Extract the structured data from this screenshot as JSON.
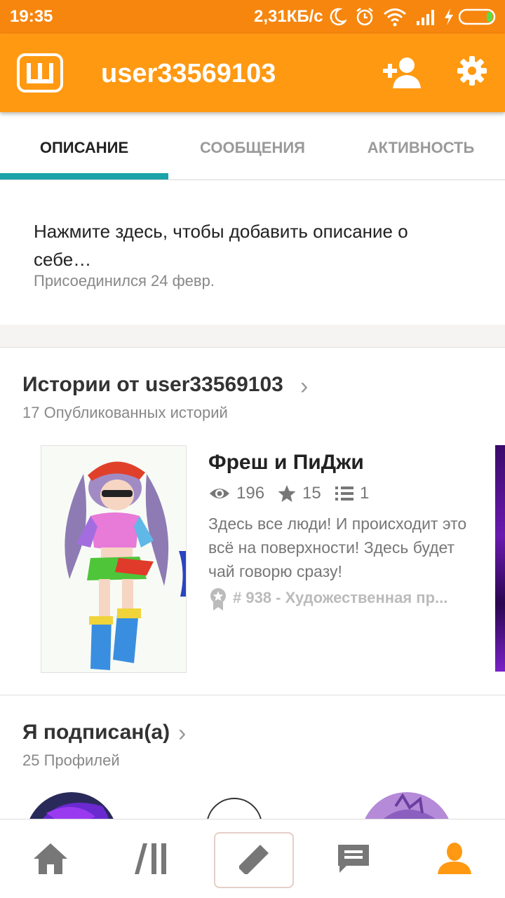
{
  "status_bar": {
    "time": "19:35",
    "network_speed": "2,31КБ/с"
  },
  "app_bar": {
    "logo_letter": "Ш",
    "username": "user33569103"
  },
  "tabs": [
    {
      "label": "ОПИСАНИЕ",
      "active": true
    },
    {
      "label": "СООБЩЕНИЯ",
      "active": false
    },
    {
      "label": "АКТИВНОСТЬ",
      "active": false
    }
  ],
  "profile": {
    "description_placeholder": "Нажмите здесь, чтобы добавить описание о себе…",
    "joined": "Присоединился 24 февр."
  },
  "stories_section": {
    "title": "Истории от user33569103",
    "subtitle": "17 Опубликованных историй",
    "story": {
      "title": "Фреш и ПиДжи",
      "views": "196",
      "votes": "15",
      "parts": "1",
      "description": "Здесь все люди! И происходит это всё на поверхности! Здесь будет чай говорю сразу!",
      "rank": "# 938 - Художественная пр..."
    }
  },
  "following_section": {
    "title": "Я подписан(а)",
    "subtitle": "25 Профилей"
  },
  "colors": {
    "brand": "#ff9912",
    "status_bar": "#f7860e",
    "tab_indicator": "#1aa3a8",
    "active_nav": "#ff9912"
  },
  "bottom_nav": [
    "home-icon",
    "library-icon",
    "write-icon",
    "messages-icon",
    "profile-icon"
  ]
}
